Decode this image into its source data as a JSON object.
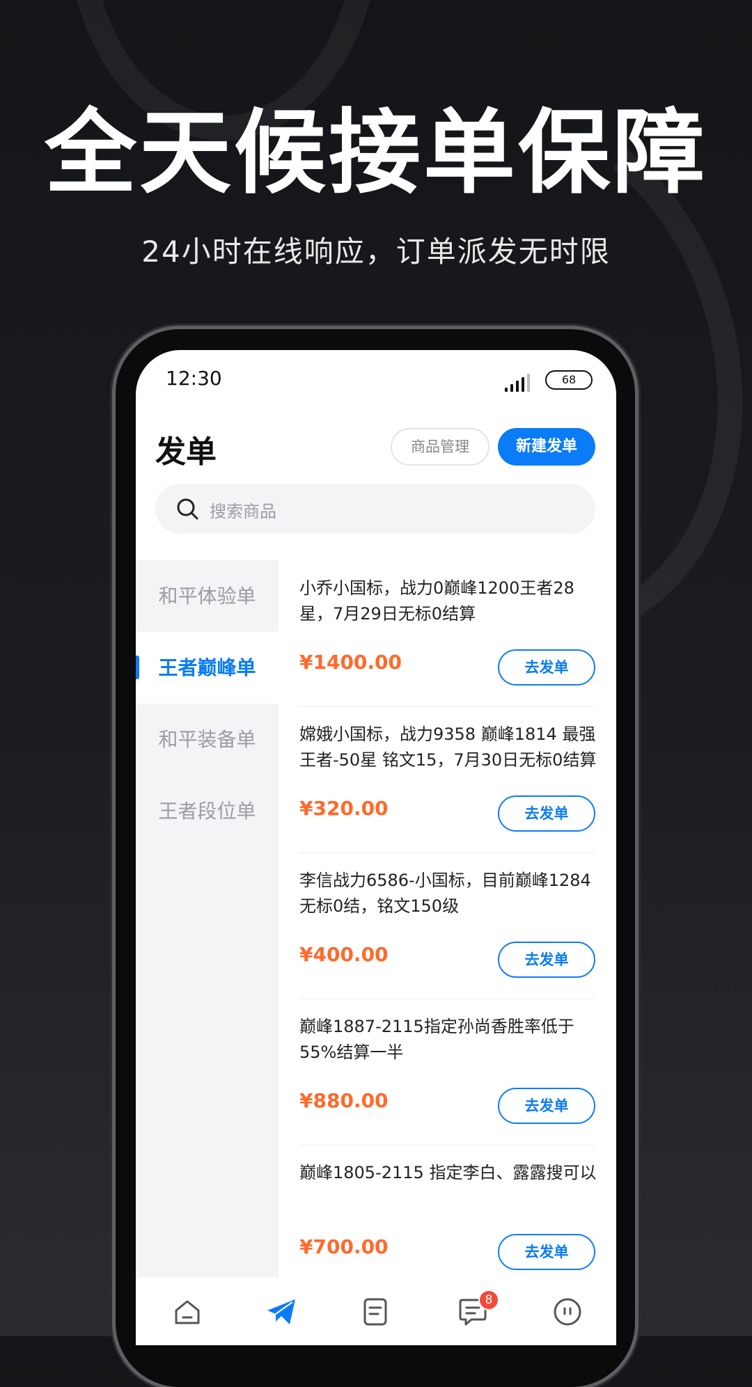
{
  "headline": "全天候接单保障",
  "subline": "24小时在线响应，订单派发无时限",
  "status": {
    "time": "12:30",
    "battery": "68"
  },
  "header": {
    "title": "发单",
    "manage_label": "商品管理",
    "new_label": "新建发单"
  },
  "search": {
    "placeholder": "搜索商品"
  },
  "categories": [
    {
      "label": "和平体验单"
    },
    {
      "label": "王者巅峰单"
    },
    {
      "label": "和平装备单"
    },
    {
      "label": "王者段位单"
    }
  ],
  "active_category": "王者巅峰单",
  "orders": [
    {
      "desc": "小乔小国标，战力0巅峰1200王者28星，7月29日无标0结算",
      "price": "¥1400.00",
      "action": "去发单"
    },
    {
      "desc": "嫦娥小国标，战力9358  巅峰1814  最强王者-50星 铭文15，7月30日无标0结算",
      "price": "¥320.00",
      "action": "去发单"
    },
    {
      "desc": "李信战力6586-小国标，目前巅峰1284无标0结，铭文150级",
      "price": "¥400.00",
      "action": "去发单"
    },
    {
      "desc": "巅峰1887-2115指定孙尚香胜率低于55%结算一半",
      "price": "¥880.00",
      "action": "去发单"
    },
    {
      "desc": "巅峰1805-2115  指定李白、露露搜可以",
      "price": "¥700.00",
      "action": "去发单"
    }
  ],
  "tabbar": {
    "items": [
      {
        "icon": "home-icon"
      },
      {
        "icon": "send-icon"
      },
      {
        "icon": "orders-icon"
      },
      {
        "icon": "messages-icon"
      },
      {
        "icon": "profile-icon"
      }
    ],
    "message_badge": "8"
  },
  "colors": {
    "accent": "#0a7cf5",
    "price": "#ff6a2b",
    "badge": "#f24b3c"
  }
}
